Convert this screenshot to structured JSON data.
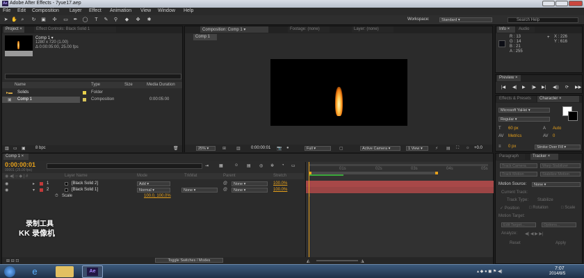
{
  "window": {
    "title": "Adobe After Effects - 7yue17.aep"
  },
  "menu": [
    "File",
    "Edit",
    "Composition",
    "Layer",
    "Effect",
    "Animation",
    "View",
    "Window",
    "Help"
  ],
  "workspace": {
    "label": "Workspace:",
    "value": "Standard",
    "search_placeholder": "Search Help"
  },
  "project": {
    "tab": "Project ×",
    "tab2": "Effect Controls: Black Solid 1",
    "item_name": "Comp 1 ▾",
    "item_size": "1280 x 720 (1.00)",
    "item_duration": "Δ 0:00:05:00, 25.00 fps",
    "columns": [
      "Name",
      "Type",
      "Size",
      "Media Duration"
    ],
    "items": [
      {
        "name": "Solids",
        "type": "Folder",
        "size": "",
        "duration": ""
      },
      {
        "name": "Comp 1",
        "type": "Composition",
        "size": "",
        "duration": "0:00:05:00"
      }
    ],
    "bpc": "8 bpc"
  },
  "viewer": {
    "tab": "Composition: Comp 1 ▾",
    "footage_tab": "Footage: (none)",
    "layer_tab": "Layer: (none)",
    "comp_label": "Comp 1",
    "zoom": "25%",
    "timecode": "0:00:00:01",
    "resolution": "Full",
    "camera": "Active Camera",
    "views": "1 View",
    "offset": "+0.0"
  },
  "info": {
    "tab": "Info ×",
    "tab2": "Audio",
    "r": "R : 13",
    "g": "G : 14",
    "b": "B : 21",
    "a": "A : 255",
    "x": "X : 226",
    "y": "Y : 616"
  },
  "preview": {
    "tab": "Preview ×"
  },
  "character": {
    "tab1": "Effects & Presets",
    "tab2": "Character ×",
    "font": "Microsoft YaHei",
    "style": "Regular",
    "size": "60 px",
    "leading": "Auto",
    "tracking": "0",
    "kerning": "Metrics",
    "stroke": "0 px",
    "stroke_type": "Stroke Over Fill"
  },
  "tracker": {
    "tab1": "Paragraph",
    "tab2": "Tracker ×",
    "buttons": [
      "Track Camera",
      "Warp Stabilizer",
      "Track Motion",
      "Stabilize Motion"
    ],
    "motion_source_label": "Motion Source:",
    "motion_source": "None",
    "current_track": "Current Track:",
    "track_type": "Track Type:",
    "track_type_value": "Stabilize",
    "position": "Position",
    "rotation": "Rotation",
    "scale": "Scale",
    "motion_target": "Motion Target:",
    "edit_target": "Edit Target...",
    "options": "Options...",
    "analyze": "Analyze:",
    "reset": "Reset",
    "apply": "Apply"
  },
  "timeline": {
    "tab": "Comp 1 ×",
    "timecode": "0:00:00:01",
    "fps": "00001 (25.00 fps)",
    "columns": {
      "name": "Layer Name",
      "mode": "Mode",
      "trkmat": "TrkMat",
      "parent": "Parent",
      "stretch": "Stretch"
    },
    "layers": [
      {
        "num": "1",
        "name": "[Black Solid 2]",
        "mode": "Add",
        "trkmat": "",
        "parent": "None",
        "stretch": "100.0%"
      },
      {
        "num": "2",
        "name": "[Black Solid 1]",
        "mode": "Normal",
        "trkmat": "None",
        "parent": "None",
        "stretch": "100.0%"
      }
    ],
    "scale_label": "Scale",
    "scale_value": "100.0, 100.0%",
    "ruler": [
      "01s",
      "02s",
      "03s",
      "04s",
      "05s"
    ],
    "toggle": "Toggle Switches / Modes"
  },
  "watermark": {
    "line1": "录制工具",
    "line2": "KK 录像机"
  },
  "taskbar": {
    "time": "7:07",
    "date": "2014/8/5",
    "ae_label": "Ae"
  },
  "colors": {
    "accent": "#e7a11b",
    "layer_bar": "#a84848",
    "workarea": "#5a5a5a"
  }
}
